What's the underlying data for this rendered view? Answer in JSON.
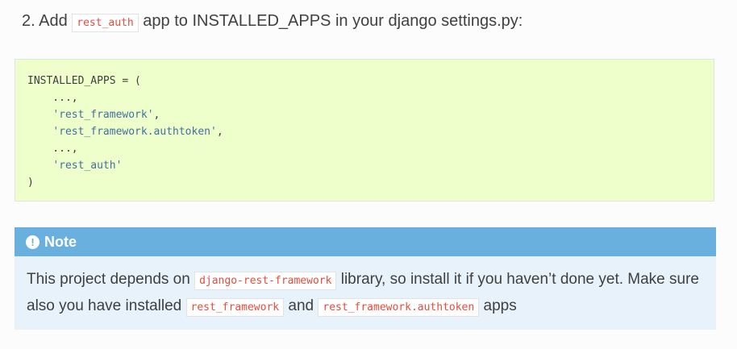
{
  "step": {
    "prefix": "2. Add",
    "code": "rest_auth",
    "suffix": "app to INSTALLED_APPS in your django settings.py:"
  },
  "code_block": {
    "lines": [
      "INSTALLED_APPS = (",
      "    ...,",
      "    'rest_framework',",
      "    'rest_framework.authtoken',",
      "    ...,",
      "    'rest_auth'",
      ")"
    ]
  },
  "note": {
    "icon": "exclamation-circle-icon",
    "title": "Note",
    "text1": "This project depends on",
    "code1": "django-rest-framework",
    "text2": "library, so install it if you haven’t done yet. Make sure also you have installed",
    "code2": "rest_framework",
    "text3": "and",
    "code3": "rest_framework.authtoken",
    "text4": "apps"
  },
  "colors": {
    "note_header": "#6ab0de",
    "note_body": "#e7f2fa",
    "code_bg": "#eeffcc",
    "inline_code": "#e74c3c"
  }
}
